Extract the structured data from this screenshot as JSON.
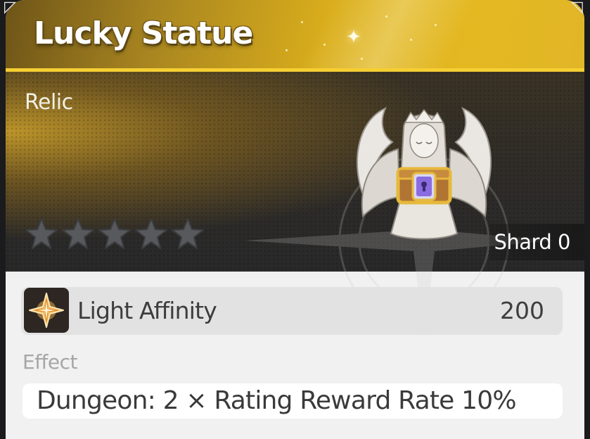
{
  "item": {
    "title": "Lucky Statue",
    "category": "Relic",
    "star_rating": 0,
    "star_max": 5,
    "shard_label": "Shard 0"
  },
  "affinity": {
    "icon": "light-affinity-compass-star-icon",
    "label": "Light Affinity",
    "value": "200"
  },
  "effect": {
    "label": "Effect",
    "text": "Dungeon: 2 ×  Rating Reward Rate 10%"
  },
  "colors": {
    "header_gold": "#d9ad1c",
    "gold_line": "#f5cf33",
    "panel_dark": "#2f2c28",
    "star_empty": "#57595c",
    "card_bg": "#f1f1f1"
  }
}
